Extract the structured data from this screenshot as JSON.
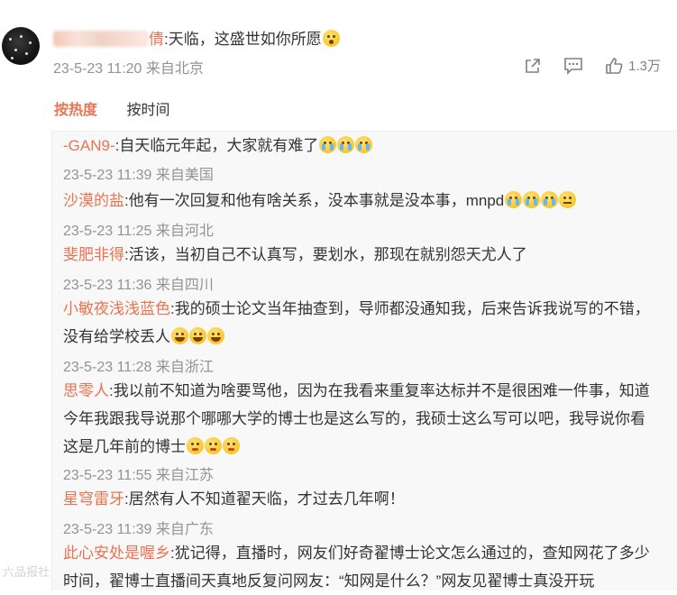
{
  "post": {
    "author_suffix": "倩",
    "text": ":天临，这盛世如你所愿",
    "time": "23-5-23 11:20",
    "location": "来自北京",
    "like_count": "1.3万"
  },
  "tabs": [
    "按热度",
    "按时间"
  ],
  "replies": [
    {
      "name": "-GAN9-",
      "text": ":自天临元年起，大家就有难了",
      "emojis": [
        "cry",
        "cry",
        "cry"
      ],
      "time": "23-5-23 11:39",
      "location": "来自美国"
    },
    {
      "name": "沙漠的盐",
      "text": ":他有一次回复和他有啥关系，没本事就是没本事，mnpd",
      "emojis": [
        "cry",
        "cry",
        "cry",
        "roll"
      ],
      "time": "23-5-23 11:25",
      "location": "来自河北"
    },
    {
      "name": "斐肥非得",
      "text": ":活该，当初自己不认真写，要划水，那现在就别怨天尤人了",
      "emojis": [],
      "time": "23-5-23 11:36",
      "location": "来自四川"
    },
    {
      "name": "小敏夜浅浅蓝色",
      "text": ":我的硕士论文当年抽查到，导师都没通知我，后来告诉我说写的不错，没有给学校丢人",
      "emojis": [
        "laugh",
        "laugh",
        "laugh"
      ],
      "time": "23-5-23 11:28",
      "location": "来自浙江"
    },
    {
      "name": "思零人",
      "text": ":我以前不知道为啥要骂他，因为在我看来重复率达标并不是很困难一件事，知道今年我跟我导说那个哪哪大学的博士也是这么写的，我硕士这么写可以吧，我导说你看这是几年前的博士",
      "emojis": [
        "shy",
        "shy",
        "shy"
      ],
      "time": "23-5-23 11:55",
      "location": "来自江苏"
    },
    {
      "name": "星穹雷牙",
      "text": ":居然有人不知道翟天临，才过去几年啊！",
      "emojis": [],
      "time": "23-5-23 11:39",
      "location": "来自广东"
    },
    {
      "name": "此心安处是喔乡",
      "text": ":犹记得，直播时，网友们好奇翟博士论文怎么通过的，查知网花了多少时间，翟博士直播间天真地反复问网友：“知网是什么？”网友见翟博士真没开玩",
      "emojis": [],
      "time": "",
      "location": ""
    }
  ],
  "watermark": "六品报社"
}
